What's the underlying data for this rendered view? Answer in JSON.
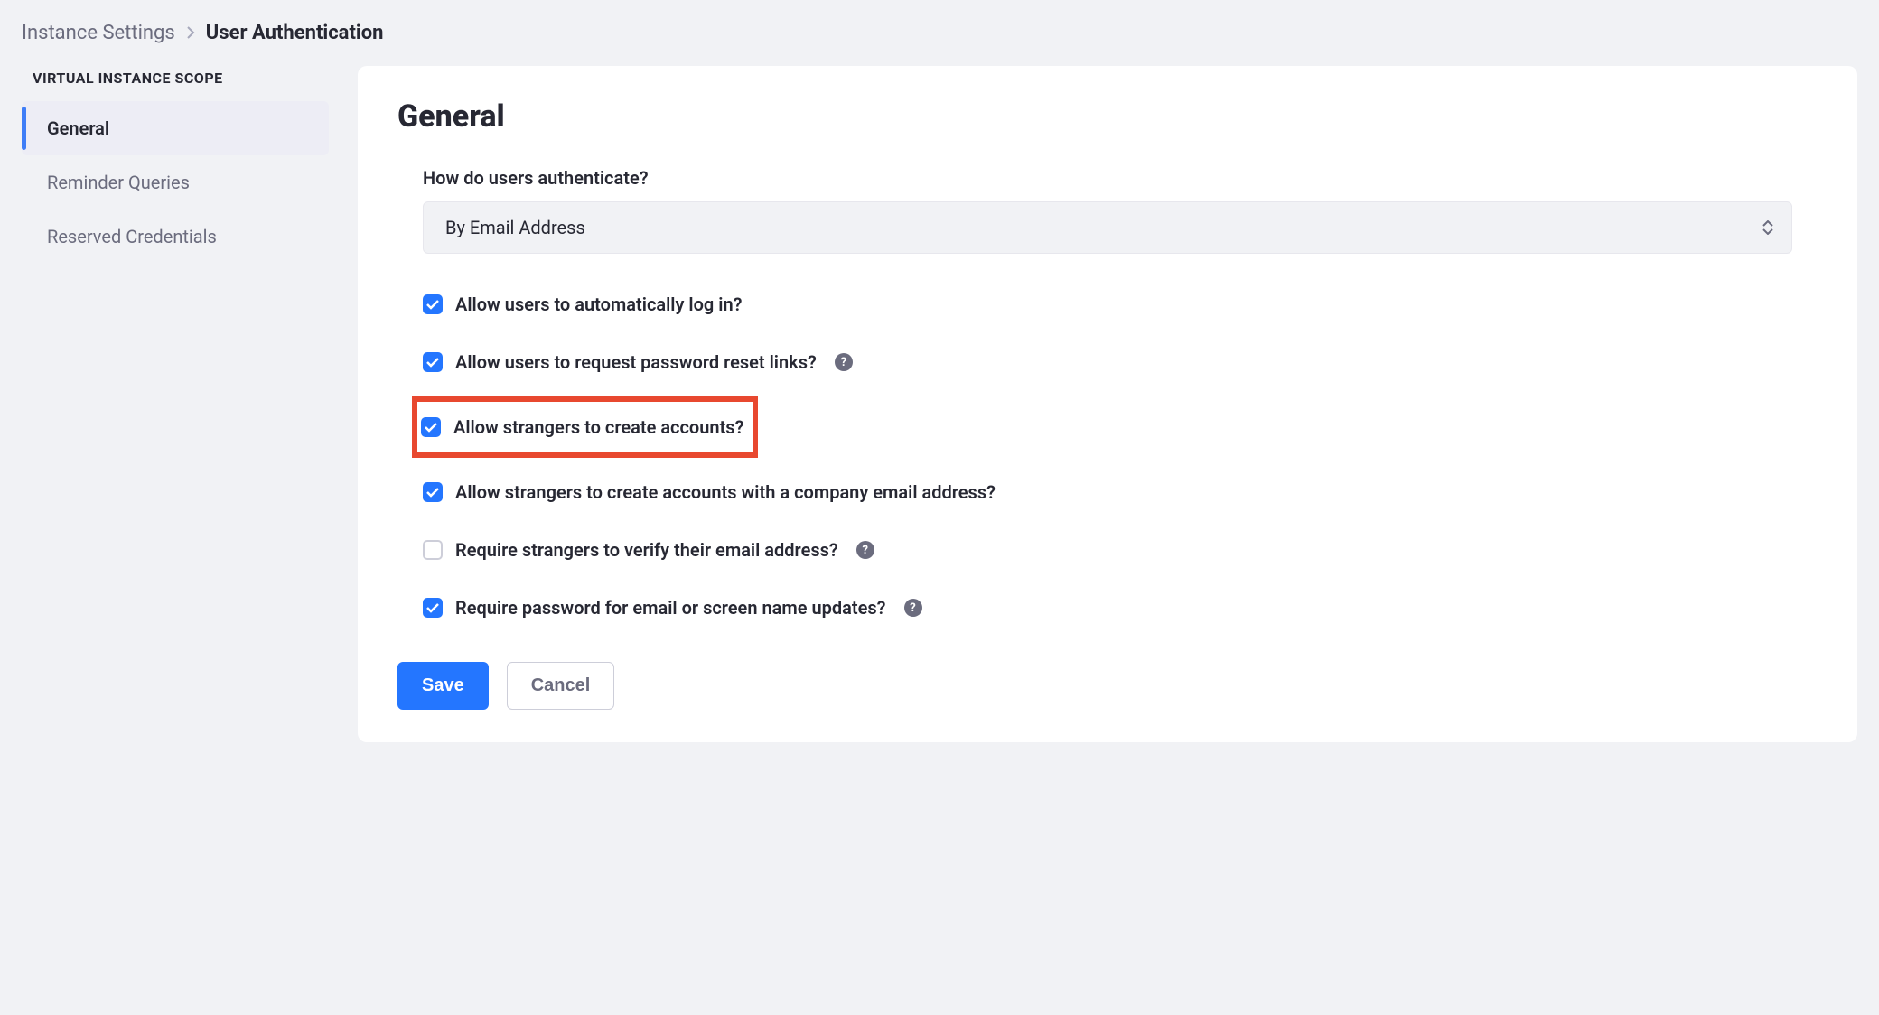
{
  "breadcrumb": {
    "parent": "Instance Settings",
    "current": "User Authentication"
  },
  "sidebar": {
    "heading": "VIRTUAL INSTANCE SCOPE",
    "items": [
      {
        "label": "General",
        "active": true
      },
      {
        "label": "Reminder Queries",
        "active": false
      },
      {
        "label": "Reserved Credentials",
        "active": false
      }
    ]
  },
  "panel": {
    "title": "General",
    "authLabel": "How do users authenticate?",
    "authSelected": "By Email Address",
    "checks": [
      {
        "label": "Allow users to automatically log in?",
        "checked": true,
        "help": false,
        "highlight": false
      },
      {
        "label": "Allow users to request password reset links?",
        "checked": true,
        "help": true,
        "highlight": false
      },
      {
        "label": "Allow strangers to create accounts?",
        "checked": true,
        "help": false,
        "highlight": true
      },
      {
        "label": "Allow strangers to create accounts with a company email address?",
        "checked": true,
        "help": false,
        "highlight": false
      },
      {
        "label": "Require strangers to verify their email address?",
        "checked": false,
        "help": true,
        "highlight": false
      },
      {
        "label": "Require password for email or screen name updates?",
        "checked": true,
        "help": true,
        "highlight": false
      }
    ],
    "saveLabel": "Save",
    "cancelLabel": "Cancel"
  }
}
